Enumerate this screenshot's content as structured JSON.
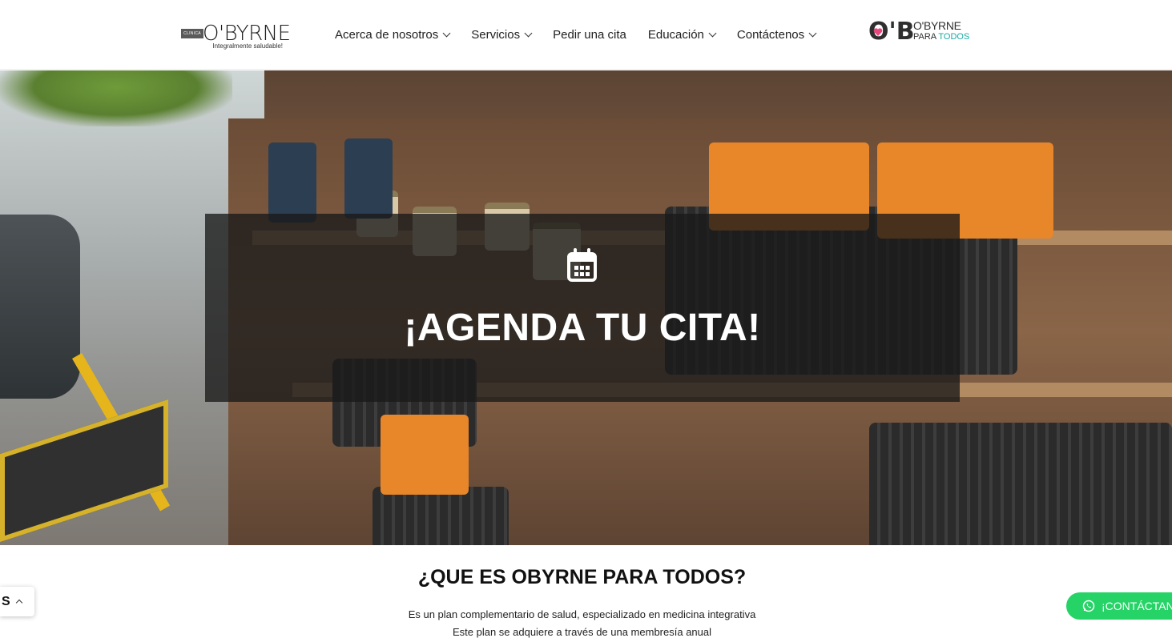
{
  "header": {
    "logo": {
      "badge": "CLINICA",
      "name": "O'BYRNE",
      "tagline": "Integralmente saludable!"
    },
    "nav": [
      {
        "label": "Acerca de nosotros",
        "has_dropdown": true
      },
      {
        "label": "Servicios",
        "has_dropdown": true
      },
      {
        "label": "Pedir una cita",
        "has_dropdown": false
      },
      {
        "label": "Educación",
        "has_dropdown": true
      },
      {
        "label": "Contáctenos",
        "has_dropdown": true
      }
    ],
    "partner_logo": {
      "mark": "O'B",
      "line1": "O'BYRNE",
      "line2_a": "PARA",
      "line2_b": "TODOS"
    }
  },
  "hero": {
    "icon": "calendar-icon",
    "title": "¡AGENDA TU CITA!"
  },
  "section": {
    "title": "¿QUE ES OBYRNE PARA TODOS?",
    "paragraph_1": "Es un plan complementario de salud, especializado en medicina integrativa",
    "paragraph_2": "Este plan se adquiere a través de una membresía anual"
  },
  "language_tab": {
    "label": "S"
  },
  "whatsapp_button": {
    "label": "¡CONTÁCTANOS!",
    "icon": "whatsapp-icon"
  },
  "colors": {
    "whatsapp": "#25d366",
    "teal_accent": "#18a9a5",
    "overlay": "#191919"
  }
}
